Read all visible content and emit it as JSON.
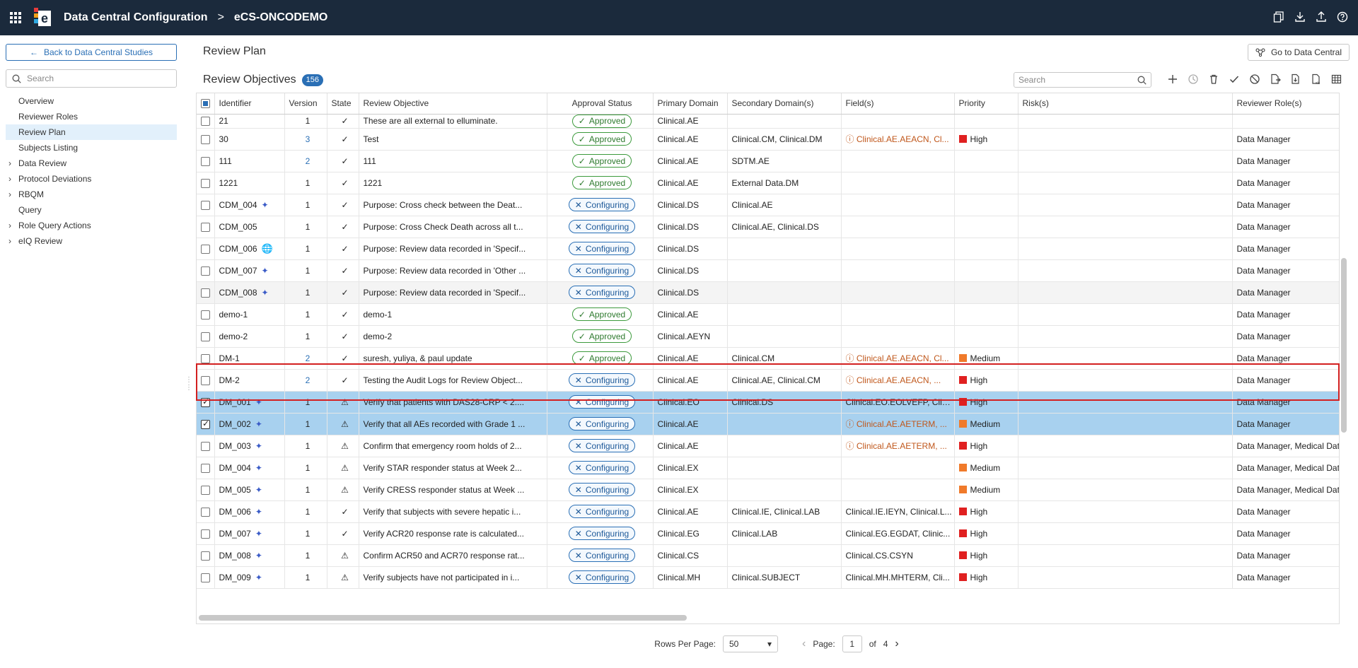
{
  "header": {
    "app_title": "Data Central Configuration",
    "separator": ">",
    "study": "eCS-ONCODEMO",
    "actions": [
      "copy-icon",
      "download-icon",
      "upload-icon",
      "help-icon"
    ]
  },
  "sidebar": {
    "back_label": "Back to Data Central Studies",
    "search_placeholder": "Search",
    "items": [
      {
        "label": "Overview",
        "expandable": false,
        "active": false
      },
      {
        "label": "Reviewer Roles",
        "expandable": false,
        "active": false
      },
      {
        "label": "Review Plan",
        "expandable": false,
        "active": true
      },
      {
        "label": "Subjects Listing",
        "expandable": false,
        "active": false
      },
      {
        "label": "Data Review",
        "expandable": true,
        "active": false
      },
      {
        "label": "Protocol Deviations",
        "expandable": true,
        "active": false
      },
      {
        "label": "RBQM",
        "expandable": true,
        "active": false
      },
      {
        "label": "Query",
        "expandable": false,
        "active": false
      },
      {
        "label": "Role Query Actions",
        "expandable": true,
        "active": false
      },
      {
        "label": "eIQ Review",
        "expandable": true,
        "active": false
      }
    ]
  },
  "main": {
    "page_title": "Review Plan",
    "goto_label": "Go to Data Central",
    "section_title": "Review Objectives",
    "count": "156",
    "search_placeholder": "Search",
    "toolbar_icons": [
      "add-icon",
      "history-icon",
      "delete-icon",
      "approve-icon",
      "disable-icon",
      "export-icon",
      "import-icon",
      "export-xls-icon",
      "columns-icon"
    ]
  },
  "table": {
    "columns": [
      "Identifier",
      "Version",
      "State",
      "Review Objective",
      "Approval Status",
      "Primary Domain",
      "Secondary Domain(s)",
      "Field(s)",
      "Priority",
      "Risk(s)",
      "Reviewer Role(s)"
    ],
    "rows": [
      {
        "id": "21",
        "version": "1",
        "state": "✓",
        "objective": "These are all external to elluminate.",
        "status": "Approved",
        "primary": "Clinical.AE",
        "secondary": "",
        "fields": "",
        "fields_warn": false,
        "priority": "",
        "risks": "",
        "roles": "",
        "partial": true
      },
      {
        "id": "30",
        "version": "3",
        "state": "✓",
        "objective": "Test",
        "status": "Approved",
        "primary": "Clinical.AE",
        "secondary": "Clinical.CM, Clinical.DM",
        "fields": "Clinical.AE.AEACN, Cl...",
        "fields_warn": true,
        "priority": "High",
        "risks": "",
        "roles": "Data Manager"
      },
      {
        "id": "111",
        "version": "2",
        "state": "✓",
        "objective": "111",
        "status": "Approved",
        "primary": "Clinical.AE",
        "secondary": "SDTM.AE",
        "fields": "",
        "fields_warn": false,
        "priority": "",
        "risks": "",
        "roles": "Data Manager"
      },
      {
        "id": "1221",
        "version": "1",
        "state": "✓",
        "objective": "1221",
        "status": "Approved",
        "primary": "Clinical.AE",
        "secondary": "External Data.DM",
        "fields": "",
        "fields_warn": false,
        "priority": "",
        "risks": "",
        "roles": "Data Manager"
      },
      {
        "id": "CDM_004",
        "icon": "sparkle",
        "version": "1",
        "state": "✓",
        "objective": "Purpose: Cross check between the Deat...",
        "status": "Configuring",
        "primary": "Clinical.DS",
        "secondary": "Clinical.AE",
        "fields": "",
        "fields_warn": false,
        "priority": "",
        "risks": "",
        "roles": "Data Manager"
      },
      {
        "id": "CDM_005",
        "version": "1",
        "state": "✓",
        "objective": "Purpose: Cross Check Death across all t...",
        "status": "Configuring",
        "primary": "Clinical.DS",
        "secondary": "Clinical.AE, Clinical.DS",
        "fields": "",
        "fields_warn": false,
        "priority": "",
        "risks": "",
        "roles": "Data Manager"
      },
      {
        "id": "CDM_006",
        "icon": "globe",
        "version": "1",
        "state": "✓",
        "objective": "Purpose: Review data recorded in 'Specif...",
        "status": "Configuring",
        "primary": "Clinical.DS",
        "secondary": "",
        "fields": "",
        "fields_warn": false,
        "priority": "",
        "risks": "",
        "roles": "Data Manager"
      },
      {
        "id": "CDM_007",
        "icon": "sparkle",
        "version": "1",
        "state": "✓",
        "objective": "Purpose: Review data recorded in 'Other ...",
        "status": "Configuring",
        "primary": "Clinical.DS",
        "secondary": "",
        "fields": "",
        "fields_warn": false,
        "priority": "",
        "risks": "",
        "roles": "Data Manager"
      },
      {
        "id": "CDM_008",
        "icon": "sparkle",
        "version": "1",
        "state": "✓",
        "objective": "Purpose: Review data recorded in 'Specif...",
        "status": "Configuring",
        "primary": "Clinical.DS",
        "secondary": "",
        "fields": "",
        "fields_warn": false,
        "priority": "",
        "risks": "",
        "roles": "Data Manager",
        "hover": true
      },
      {
        "id": "demo-1",
        "version": "1",
        "state": "✓",
        "objective": "demo-1",
        "status": "Approved",
        "primary": "Clinical.AE",
        "secondary": "",
        "fields": "",
        "fields_warn": false,
        "priority": "",
        "risks": "",
        "roles": "Data Manager"
      },
      {
        "id": "demo-2",
        "version": "1",
        "state": "✓",
        "objective": "demo-2",
        "status": "Approved",
        "primary": "Clinical.AEYN",
        "secondary": "",
        "fields": "",
        "fields_warn": false,
        "priority": "",
        "risks": "",
        "roles": "Data Manager"
      },
      {
        "id": "DM-1",
        "version": "2",
        "state": "✓",
        "objective": "suresh, yuliya, & paul update",
        "status": "Approved",
        "primary": "Clinical.AE",
        "secondary": "Clinical.CM",
        "fields": "Clinical.AE.AEACN, Cl...",
        "fields_warn": true,
        "priority": "Medium",
        "risks": "",
        "roles": "Data Manager"
      },
      {
        "id": "DM-2",
        "version": "2",
        "state": "✓",
        "objective": "Testing the Audit Logs for Review Object...",
        "status": "Configuring",
        "primary": "Clinical.AE",
        "secondary": "Clinical.AE, Clinical.CM",
        "fields": "Clinical.AE.AEACN, ...",
        "fields_warn": true,
        "priority": "High",
        "risks": "",
        "roles": "Data Manager"
      },
      {
        "id": "DM_001",
        "icon": "sparkle",
        "version": "1",
        "state": "⚠",
        "objective": "Verify that patients with DAS28-CRP < 2....",
        "status": "Configuring",
        "primary": "Clinical.EO",
        "secondary": "Clinical.DS",
        "fields": "Clinical.EO.EOLVEFP, Clini...",
        "fields_warn": false,
        "priority": "High",
        "risks": "",
        "roles": "Data Manager",
        "selected": true
      },
      {
        "id": "DM_002",
        "icon": "sparkle",
        "version": "1",
        "state": "⚠",
        "objective": "Verify that all AEs recorded with Grade 1 ...",
        "status": "Configuring",
        "primary": "Clinical.AE",
        "secondary": "",
        "fields": "Clinical.AE.AETERM, ...",
        "fields_warn": true,
        "priority": "Medium",
        "risks": "",
        "roles": "Data Manager",
        "selected": true
      },
      {
        "id": "DM_003",
        "icon": "sparkle",
        "version": "1",
        "state": "⚠",
        "objective": "Confirm that emergency room holds of 2...",
        "status": "Configuring",
        "primary": "Clinical.AE",
        "secondary": "",
        "fields": "Clinical.AE.AETERM, ...",
        "fields_warn": true,
        "priority": "High",
        "risks": "",
        "roles": "Data Manager, Medical Data Rev"
      },
      {
        "id": "DM_004",
        "icon": "sparkle",
        "version": "1",
        "state": "⚠",
        "objective": "Verify STAR responder status at Week 2...",
        "status": "Configuring",
        "primary": "Clinical.EX",
        "secondary": "",
        "fields": "",
        "fields_warn": false,
        "priority": "Medium",
        "risks": "",
        "roles": "Data Manager, Medical Data Rev"
      },
      {
        "id": "DM_005",
        "icon": "sparkle",
        "version": "1",
        "state": "⚠",
        "objective": "Verify CRESS responder status at Week ...",
        "status": "Configuring",
        "primary": "Clinical.EX",
        "secondary": "",
        "fields": "",
        "fields_warn": false,
        "priority": "Medium",
        "risks": "",
        "roles": "Data Manager, Medical Data Rev"
      },
      {
        "id": "DM_006",
        "icon": "sparkle",
        "version": "1",
        "state": "✓",
        "objective": "Verify that subjects with severe hepatic i...",
        "status": "Configuring",
        "primary": "Clinical.AE",
        "secondary": "Clinical.IE, Clinical.LAB",
        "fields": "Clinical.IE.IEYN, Clinical.L...",
        "fields_warn": false,
        "priority": "High",
        "risks": "",
        "roles": "Data Manager"
      },
      {
        "id": "DM_007",
        "icon": "sparkle",
        "version": "1",
        "state": "✓",
        "objective": "Verify ACR20 response rate is calculated...",
        "status": "Configuring",
        "primary": "Clinical.EG",
        "secondary": "Clinical.LAB",
        "fields": "Clinical.EG.EGDAT, Clinic...",
        "fields_warn": false,
        "priority": "High",
        "risks": "",
        "roles": "Data Manager"
      },
      {
        "id": "DM_008",
        "icon": "sparkle",
        "version": "1",
        "state": "⚠",
        "objective": "Confirm ACR50 and ACR70 response rat...",
        "status": "Configuring",
        "primary": "Clinical.CS",
        "secondary": "",
        "fields": "Clinical.CS.CSYN",
        "fields_warn": false,
        "priority": "High",
        "risks": "",
        "roles": "Data Manager"
      },
      {
        "id": "DM_009",
        "icon": "sparkle",
        "version": "1",
        "state": "⚠",
        "objective": "Verify subjects have not participated in i...",
        "status": "Configuring",
        "primary": "Clinical.MH",
        "secondary": "Clinical.SUBJECT",
        "fields": "Clinical.MH.MHTERM, Cli...",
        "fields_warn": false,
        "priority": "High",
        "risks": "",
        "roles": "Data Manager"
      }
    ]
  },
  "pager": {
    "rows_label": "Rows Per Page:",
    "rows_value": "50",
    "page_label": "Page:",
    "page_value": "1",
    "of_label": "of",
    "total_pages": "4"
  },
  "colors": {
    "topbar": "#1b2a3c",
    "accent": "#2a6fb5",
    "selected_row": "#a8d1ef",
    "high": "#e02020",
    "medium": "#f07a2a",
    "approved": "#3c9a3c"
  }
}
